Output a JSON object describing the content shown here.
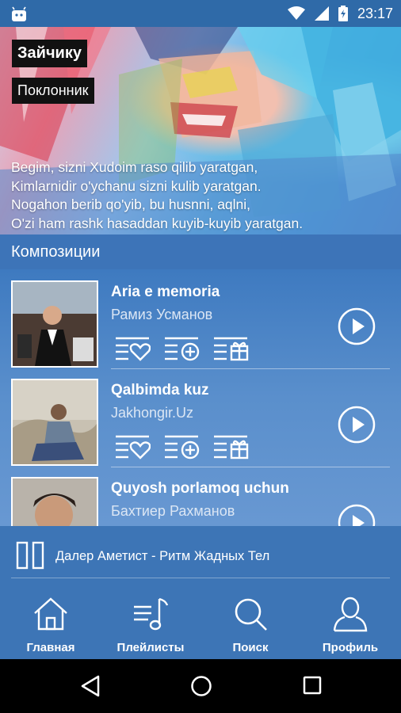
{
  "status_bar": {
    "time": "23:17"
  },
  "hero": {
    "tag_title": "Зайчику",
    "tag_subtitle": "Поклонник",
    "lyrics": [
      "Begim, sizni Xudoim raso qilib yaratgan,",
      "Kimlarnidir o'ychanu sizni kulib yaratgan.",
      "Nogahon berib qo'yib, bu husnni, aqlni,",
      "O'zi ham rashk hasaddan kuyib-kuyib yaratgan."
    ]
  },
  "section": {
    "title": "Композиции"
  },
  "tracks": [
    {
      "title": "Aria e memoria",
      "artist": "Рамиз Усманов"
    },
    {
      "title": "Qalbimda kuz",
      "artist": "Jakhongir.Uz"
    },
    {
      "title": "Quyosh porlamoq uchun",
      "artist": "Бахтиер Рахманов"
    }
  ],
  "now_playing": {
    "text": "Далер Аметист - Ритм Жадных Тел"
  },
  "bottom_nav": {
    "home": "Главная",
    "playlists": "Плейлисты",
    "search": "Поиск",
    "profile": "Профиль"
  },
  "icons": [
    "android-icon",
    "wifi-icon",
    "signal-icon",
    "battery-icon",
    "like-icon",
    "add-icon",
    "gift-icon",
    "play-icon",
    "pause-icon",
    "home-icon",
    "playlist-icon",
    "search-icon",
    "profile-icon",
    "back-icon",
    "home-circle-icon",
    "recents-icon"
  ],
  "colors": {
    "accent": "#3d75b6",
    "status_bar": "#2f6aa8",
    "nav_text": "#ffffff"
  }
}
